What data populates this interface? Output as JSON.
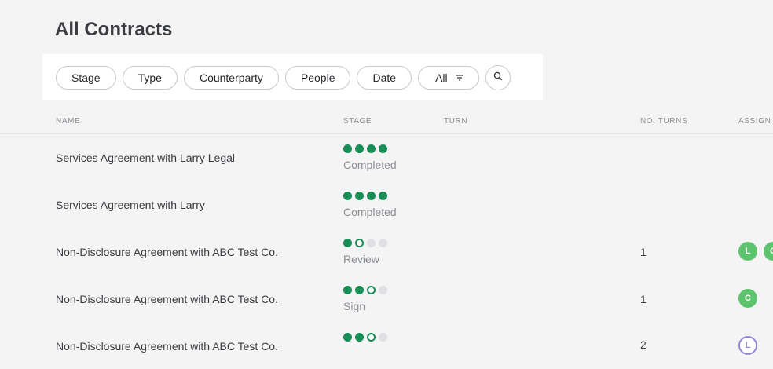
{
  "page": {
    "title": "All Contracts"
  },
  "filters": {
    "stage": "Stage",
    "type": "Type",
    "counterparty": "Counterparty",
    "people": "People",
    "date": "Date",
    "all": "All"
  },
  "columns": {
    "name": "NAME",
    "stage": "STAGE",
    "turn": "TURN",
    "turns": "NO. TURNS",
    "assign": "ASSIGN"
  },
  "rows": [
    {
      "name": "Services Agreement with Larry Legal",
      "stage": "Completed",
      "turns": "",
      "progress": [
        "done",
        "done",
        "done",
        "done"
      ],
      "avatars": []
    },
    {
      "name": "Services Agreement with Larry",
      "stage": "Completed",
      "turns": "",
      "progress": [
        "done",
        "done",
        "done",
        "done"
      ],
      "avatars": []
    },
    {
      "name": "Non-Disclosure Agreement with ABC Test Co.",
      "stage": "Review",
      "turns": "1",
      "progress": [
        "done",
        "current",
        "todo",
        "todo"
      ],
      "avatars": [
        "L",
        "C"
      ]
    },
    {
      "name": "Non-Disclosure Agreement with ABC Test Co.",
      "stage": "Sign",
      "turns": "1",
      "progress": [
        "done",
        "done",
        "current",
        "todo"
      ],
      "avatars": [
        "C"
      ]
    },
    {
      "name": "Non-Disclosure Agreement with ABC Test Co.",
      "stage": "",
      "turns": "2",
      "progress": [
        "done",
        "done",
        "current",
        "todo"
      ],
      "avatars": [
        "L"
      ]
    }
  ],
  "colors": {
    "done": "#1a8c56",
    "avatar": "#5cc46d",
    "avatarOutline": "#9a86d8"
  },
  "icons": {
    "filter": "filter-lines-icon",
    "search": "search-icon"
  }
}
